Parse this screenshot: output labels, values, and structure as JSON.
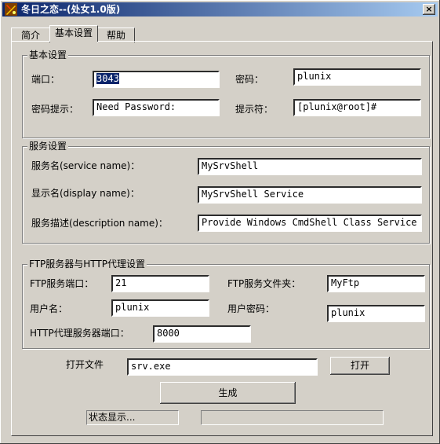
{
  "window": {
    "title": "冬日之恋--(处女1.0版)",
    "close_label": "×"
  },
  "tabs": [
    "简介",
    "基本设置",
    "帮助"
  ],
  "basic": {
    "title": "基本设置",
    "port_label": "端口：",
    "port_value": "3043",
    "password_label": "密码：",
    "password_value": "plunix",
    "hint_label": "密码提示：",
    "hint_value": "Need Password:",
    "prompt_label": "提示符：",
    "prompt_value": "[plunix@root]#"
  },
  "service": {
    "title": "服务设置",
    "name_label": "服务名(service name)：",
    "name_value": "MySrvShell",
    "display_label": "显示名(display name)：",
    "display_value": "MySrvShell Service",
    "desc_label": "服务描述(description name)：",
    "desc_value": "Provide Windows CmdShell Class Service"
  },
  "ftp": {
    "title": "FTP服务器与HTTP代理设置",
    "port_label": "FTP服务端口：",
    "port_value": "21",
    "folder_label": "FTP服务文件夹：",
    "folder_value": "MyFtp",
    "user_label": "用户名：",
    "user_value": "plunix",
    "userpass_label": "用户密码：",
    "userpass_value": "plunix",
    "http_label": "HTTP代理服务器端口：",
    "http_value": "8000"
  },
  "file": {
    "label": "打开文件",
    "value": "srv.exe",
    "open_button": "打开"
  },
  "generate_button": "生成",
  "status": {
    "text": "状态显示...",
    "progress": 0
  }
}
